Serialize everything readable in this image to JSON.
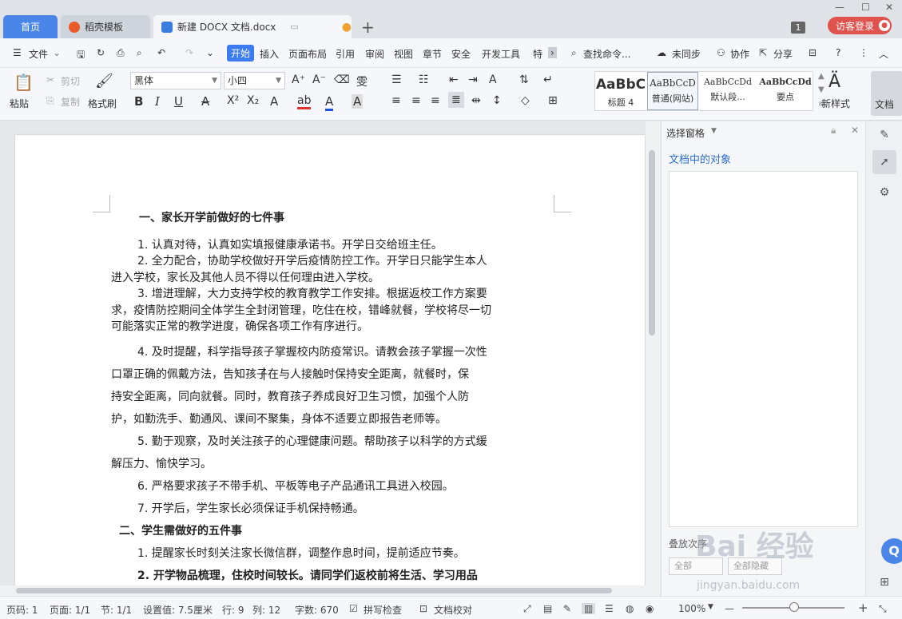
{
  "tabs": {
    "home": "首页",
    "templates": "稻壳模板",
    "document": "新建 DOCX 文档.docx",
    "plus": "+"
  },
  "titlebar": {
    "badge": "1",
    "login": "访客登录"
  },
  "menu": {
    "hamburger": "☰",
    "file": "文件",
    "items": [
      "开始",
      "插入",
      "页面布局",
      "引用",
      "审阅",
      "视图",
      "章节",
      "安全",
      "开发工具",
      "特"
    ],
    "search": "查找命令...",
    "sync": "未同步",
    "collab": "协作",
    "share": "分享"
  },
  "ribbon": {
    "paste": "粘贴",
    "cut": "剪切",
    "copy": "复制",
    "format_painter": "格式刷",
    "font_name": "黑体",
    "font_size": "小四",
    "styles": [
      {
        "preview": "AaBbC",
        "label": "标题 4"
      },
      {
        "preview": "AaBbCcD",
        "label": "普通(网站)"
      },
      {
        "preview": "AaBbCcDd",
        "label": "默认段..."
      },
      {
        "preview": "AaBbCcDd",
        "label": "要点"
      }
    ],
    "new_style": "新样式",
    "doc_helper": "文档"
  },
  "document": {
    "lines": [
      "一、家长开学前做好的七件事",
      "1. 认真对待，认真如实填报健康承诺书。开学日交给班主任。",
      "2. 全力配合，协助学校做好开学后疫情防控工作。开学日只能学生本人",
      "进入学校，家长及其他人员不得以任何理由进入学校。",
      "3. 增进理解，大力支持学校的教育教学工作安排。根据返校工作方案要",
      "求，疫情防控期间全体学生全封闭管理，吃住在校，错峰就餐，学校将尽一切",
      "可能落实正常的教学进度，确保各项工作有序进行。",
      "4. 及时提醒，科学指导孩子掌握校内防疫常识。请教会孩子掌握一次性",
      "口罩正确的佩戴方法，告知孩子在与人接触时保持安全距离，就餐时，保",
      "持安全距离，同向就餐。同时，教育孩子养成良好卫生习惯，加强个人防",
      "护，如勤洗手、勤通风、课间不聚集，身体不适要立即报告老师等。",
      "5. 勤于观察，及时关注孩子的心理健康问题。帮助孩子以科学的方式缓",
      "解压力、愉快学习。",
      "6. 严格要求孩子不带手机、平板等电子产品通讯工具进入校园。",
      "7. 开学后，学生家长必须保证手机保持畅通。",
      "二、学生需做好的五件事",
      "1. 提醒家长时刻关注家长微信群，调整作息时间，提前适应节奏。",
      "2. 开学物品梳理，住校时间较长。请同学们返校前将生活、学习用品"
    ]
  },
  "selection_pane": {
    "title": "选择窗格",
    "objects_label": "文档中的对象",
    "order_label": "叠放次序",
    "btn_all": "全部",
    "btn_hide": "全部隐藏"
  },
  "watermark": {
    "brand": "Bai 经验",
    "url": "jingyan.baidu.com"
  },
  "status": {
    "page_num": "页码: 1",
    "pages": "页面: 1/1",
    "section": "节: 1/1",
    "setting": "设置值: 7.5厘米",
    "row": "行: 9",
    "col": "列: 12",
    "wordcount": "字数: 670",
    "spellcheck": "拼写检查",
    "doccheck": "文档校对",
    "zoom": "100%"
  }
}
